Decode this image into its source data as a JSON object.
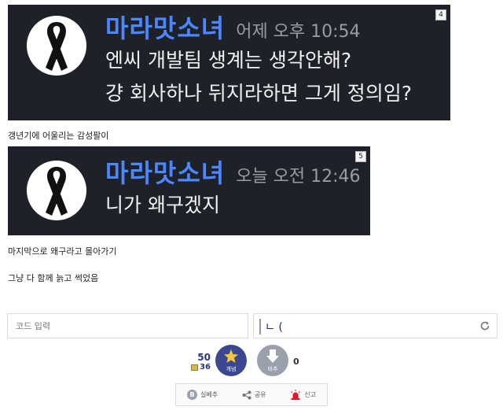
{
  "posts": [
    {
      "badge": "4",
      "nickname": "마라맛소녀",
      "time": "어제 오후 10:54",
      "lines": [
        "엔씨 개발팀 생계는 생각안해?",
        "걍 회사하나 뒤지라하면 그게 정의임?"
      ]
    },
    {
      "badge": "5",
      "nickname": "마라맛소녀",
      "time": "오늘 오전 12:46",
      "lines": [
        "니가 왜구겠지"
      ]
    }
  ],
  "captions": [
    "갱년기에 어울리는 감성팔이",
    "마지막으로 왜구라고 몰아가기",
    "그냥 다 함께 늙고 썩었음"
  ],
  "code_input": {
    "placeholder": "코드 입력"
  },
  "captcha": {
    "text": "ㄴ ("
  },
  "vote": {
    "up_count": "50",
    "sub_count": "36",
    "up_label": "개념",
    "down_label": "비추",
    "down_count": "0"
  },
  "actions": {
    "share_label": "실베추",
    "share2_label": "공유",
    "report_label": "신고",
    "b_icon_letter": "B"
  },
  "colors": {
    "chat_bg": "#1f2129",
    "nickname": "#4b88ff",
    "vote_up": "#3b4890",
    "vote_down": "#9aa0ac",
    "report": "#e3162b"
  },
  "icons": [
    "black-ribbon-icon",
    "refresh-icon",
    "star-icon",
    "arrow-down-icon",
    "b-circle-icon",
    "share-icon",
    "siren-icon"
  ]
}
